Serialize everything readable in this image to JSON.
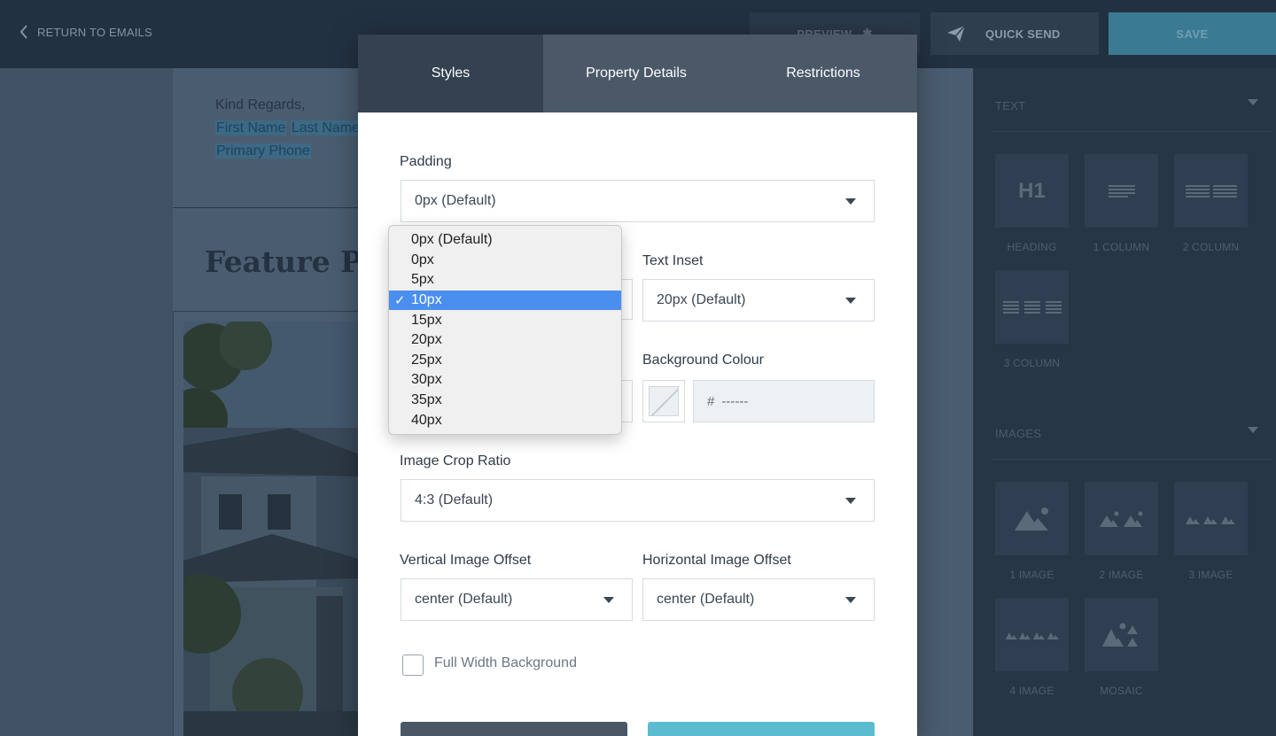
{
  "topbar": {
    "return_label": "RETURN TO EMAILS",
    "preview_label": "PREVIEW",
    "quick_send_label": "QUICK SEND",
    "save_label": "SAVE"
  },
  "email": {
    "signature_line1": "Kind Regards,",
    "first_name": "First Name",
    "last_name": "Last Name",
    "primary_phone": "Primary Phone",
    "feature_title": "Feature Pro"
  },
  "panel": {
    "text_section": "TEXT",
    "text_blocks": [
      {
        "label": "HEADING",
        "glyph": "H1"
      },
      {
        "label": "1 COLUMN"
      },
      {
        "label": "2 COLUMN"
      },
      {
        "label": "3 COLUMN"
      }
    ],
    "images_section": "IMAGES",
    "image_blocks": [
      {
        "label": "1 IMAGE"
      },
      {
        "label": "2 IMAGE"
      },
      {
        "label": "3 IMAGE"
      },
      {
        "label": "4 IMAGE"
      },
      {
        "label": "MOSAIC"
      }
    ]
  },
  "modal": {
    "tabs": [
      {
        "label": "Styles",
        "active": true
      },
      {
        "label": "Property Details",
        "active": false
      },
      {
        "label": "Restrictions",
        "active": false
      }
    ],
    "padding": {
      "label": "Padding",
      "value": "0px (Default)"
    },
    "text_inset": {
      "label": "Text Inset",
      "value": "20px (Default)"
    },
    "background_colour": {
      "label": "Background Colour",
      "hash": "#",
      "value": "------"
    },
    "image_crop_ratio": {
      "label": "Image Crop Ratio",
      "value": "4:3 (Default)"
    },
    "vertical_offset": {
      "label": "Vertical Image Offset",
      "value": "center (Default)"
    },
    "horizontal_offset": {
      "label": "Horizontal Image Offset",
      "value": "center (Default)"
    },
    "full_width_background": {
      "label": "Full Width Background",
      "checked": false
    }
  },
  "dropdown": {
    "check_glyph": "✓",
    "selected_index": 3,
    "options": [
      "0px (Default)",
      "0px",
      "5px",
      "10px",
      "15px",
      "20px",
      "25px",
      "30px",
      "35px",
      "40px"
    ]
  },
  "colors": {
    "accent_teal": "#5bbcd0",
    "selection_blue": "#4a8fef",
    "tab_active": "#344150"
  }
}
